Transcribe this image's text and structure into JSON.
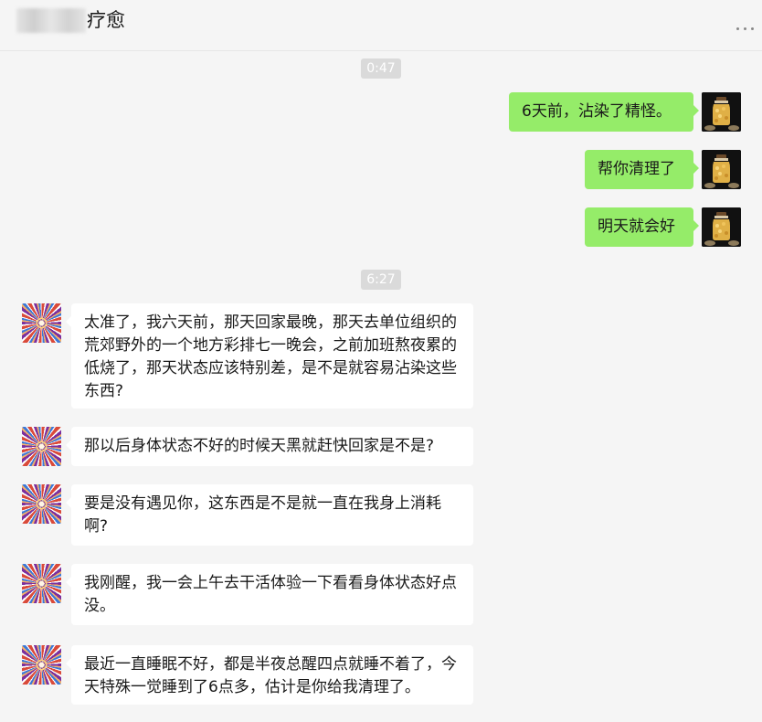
{
  "header": {
    "title_suffix": "疗愈",
    "more_icon": "more-dots-icon"
  },
  "messages_group_1": {
    "time": "0:47",
    "self": [
      {
        "text": "6天前，沾染了精怪。"
      },
      {
        "text": "帮你清理了"
      },
      {
        "text": "明天就会好"
      }
    ]
  },
  "messages_group_2": {
    "time": "6:27",
    "other": [
      {
        "text": "太准了，我六天前，那天回家最晚，那天去单位组织的荒郊野外的一个地方彩排七一晚会，之前加班熬夜累的低烧了，那天状态应该特别差，是不是就容易沾染这些东西?"
      },
      {
        "text": "那以后身体状态不好的时候天黑就赶快回家是不是?"
      },
      {
        "text": "要是没有遇见你，这东西是不是就一直在我身上消耗啊?"
      },
      {
        "text": "我刚醒，我一会上午去干活体验一下看看身体状态好点没。"
      },
      {
        "text": "最近一直睡眠不好，都是半夜总醒四点就睡不着了，今天特殊一觉睡到了6点多，估计是你给我清理了。"
      }
    ]
  },
  "colors": {
    "self_bubble": "#95ec69",
    "other_bubble": "#ffffff",
    "background": "#f5f5f5"
  }
}
